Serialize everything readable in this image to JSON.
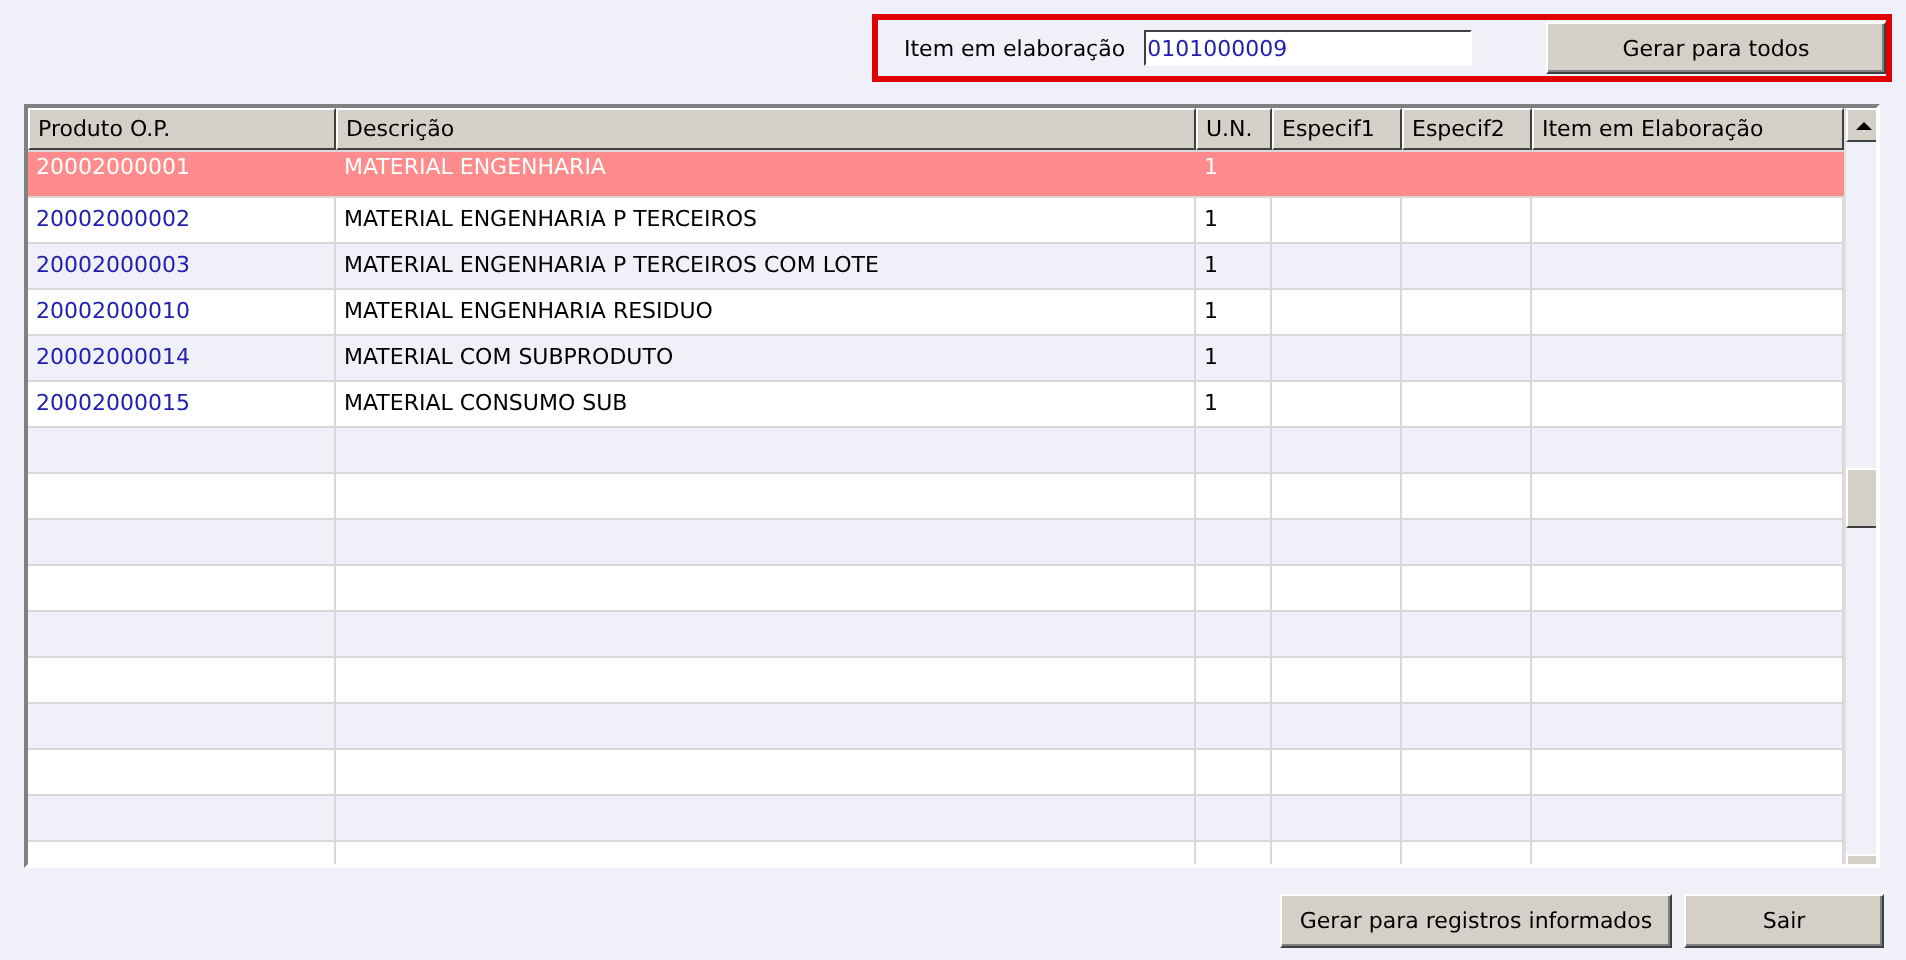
{
  "header": {
    "label": "Item em elaboração",
    "value": "0101000009",
    "button": "Gerar para todos"
  },
  "table": {
    "columns": [
      "Produto O.P.",
      "Descrição",
      "U.N.",
      "Especif1",
      "Especif2",
      "Item em Elaboração"
    ],
    "rows": [
      {
        "cells": [
          "20002000001",
          "MATERIAL ENGENHARIA",
          "1"
        ],
        "selected": true
      },
      {
        "cells": [
          "20002000002",
          "MATERIAL ENGENHARIA P TERCEIROS",
          "1"
        ],
        "selected": false
      },
      {
        "cells": [
          "20002000003",
          "MATERIAL ENGENHARIA P TERCEIROS COM LOTE",
          "1"
        ],
        "selected": false
      },
      {
        "cells": [
          "20002000010",
          "MATERIAL ENGENHARIA RESIDUO",
          "1"
        ],
        "selected": false
      },
      {
        "cells": [
          "20002000014",
          "MATERIAL COM SUBPRODUTO",
          "1"
        ],
        "selected": false
      },
      {
        "cells": [
          "20002000015",
          "MATERIAL CONSUMO SUB",
          "1"
        ],
        "selected": false
      }
    ]
  },
  "buttons": [
    "Gerar para registros informados",
    "Sair"
  ]
}
